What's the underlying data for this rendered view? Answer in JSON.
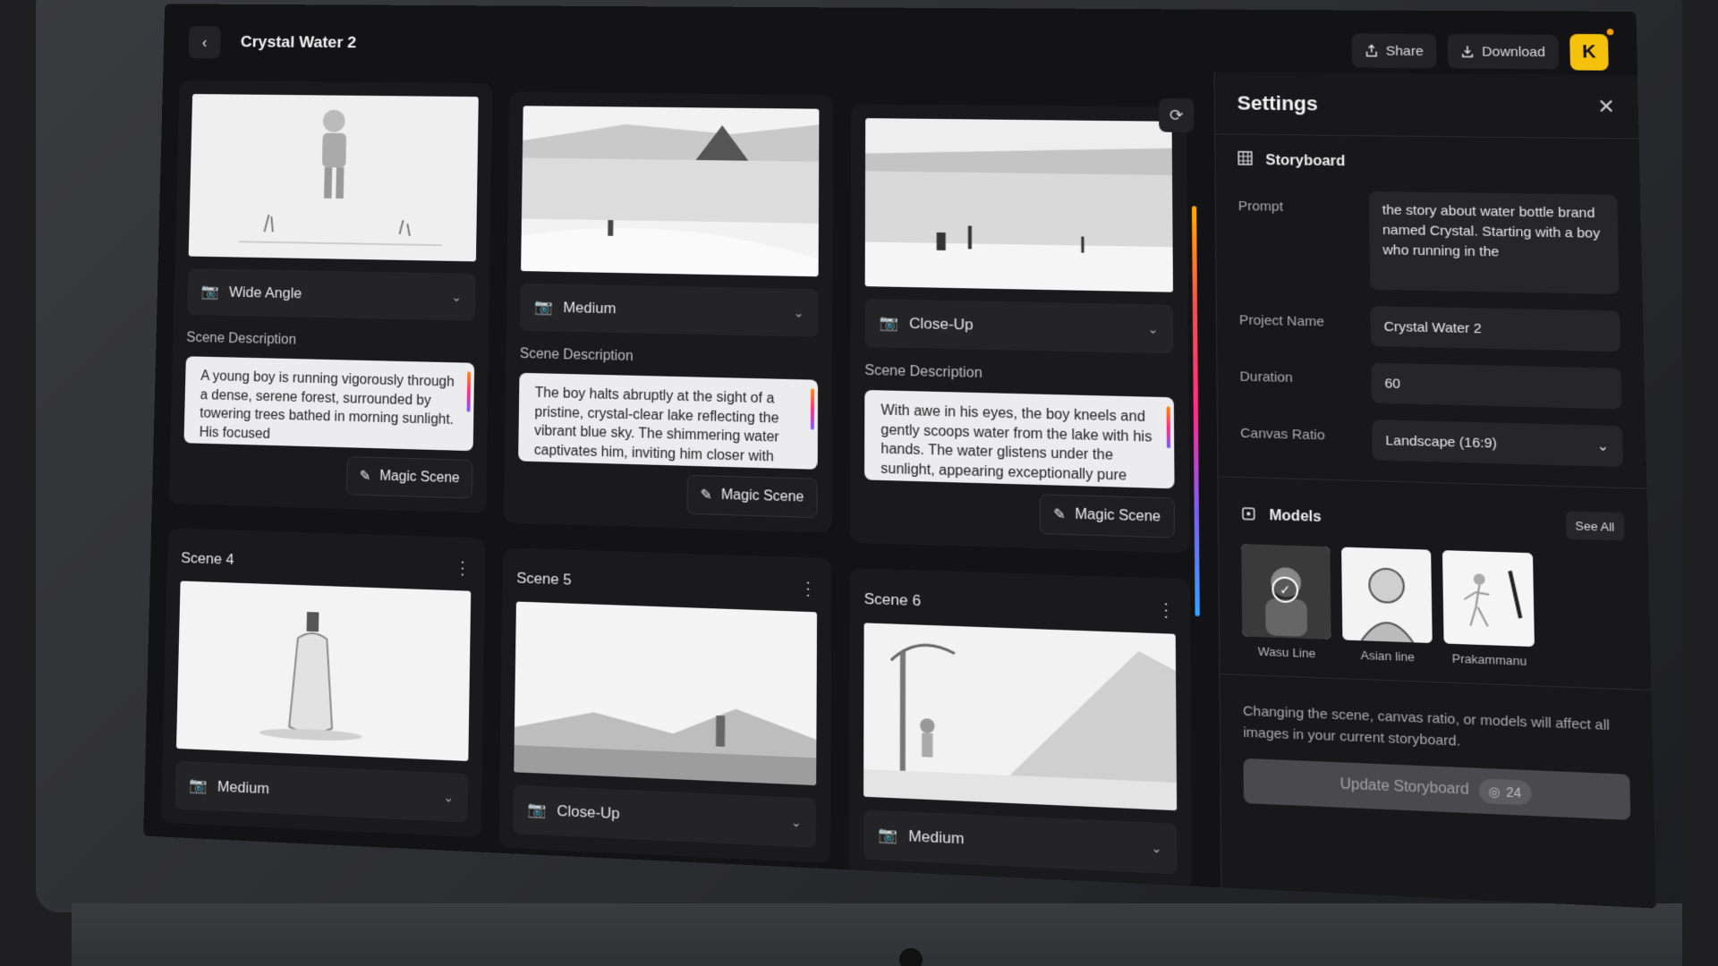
{
  "header": {
    "project_title": "Crystal Water 2",
    "share_label": "Share",
    "download_label": "Download",
    "avatar_letter": "K",
    "accent_color": "#f4c20d"
  },
  "scenes": [
    {
      "title": "",
      "shot": "Wide Angle",
      "description_label": "Scene Description",
      "description": "A young boy is running vigorously through a dense, serene forest, surrounded by towering trees bathed in morning sunlight. His focused",
      "magic_label": "Magic Scene"
    },
    {
      "title": "",
      "shot": "Medium",
      "description_label": "Scene Description",
      "description": "The boy halts abruptly at the sight of a pristine, crystal-clear lake reflecting the vibrant blue sky. The shimmering water captivates him, inviting him closer with",
      "magic_label": "Magic Scene"
    },
    {
      "title": "",
      "shot": "Close-Up",
      "description_label": "Scene Description",
      "description": "With awe in his eyes, the boy kneels and gently scoops water from the lake with his hands. The water glistens under the sunlight, appearing exceptionally pure",
      "magic_label": "Magic Scene"
    },
    {
      "title": "Scene 4",
      "shot": "Medium"
    },
    {
      "title": "Scene 5",
      "shot": "Close-Up"
    },
    {
      "title": "Scene 6",
      "shot": "Medium"
    }
  ],
  "settings": {
    "title": "Settings",
    "storyboard_label": "Storyboard",
    "prompt_label": "Prompt",
    "prompt_value": "the story about water bottle brand named Crystal. Starting with a boy who running in the",
    "project_name_label": "Project Name",
    "project_name_value": "Crystal Water 2",
    "duration_label": "Duration",
    "duration_value": "60",
    "canvas_ratio_label": "Canvas Ratio",
    "canvas_ratio_value": "Landscape (16:9)",
    "models_label": "Models",
    "see_all_label": "See All",
    "models": [
      {
        "name": "Wasu Line",
        "selected": true
      },
      {
        "name": "Asian line",
        "selected": false
      },
      {
        "name": "Prakammanu",
        "selected": false
      }
    ],
    "notice": "Changing the scene, canvas ratio, or models will affect all images in your current storyboard.",
    "update_label": "Update Storyboard",
    "update_credits": "24"
  }
}
